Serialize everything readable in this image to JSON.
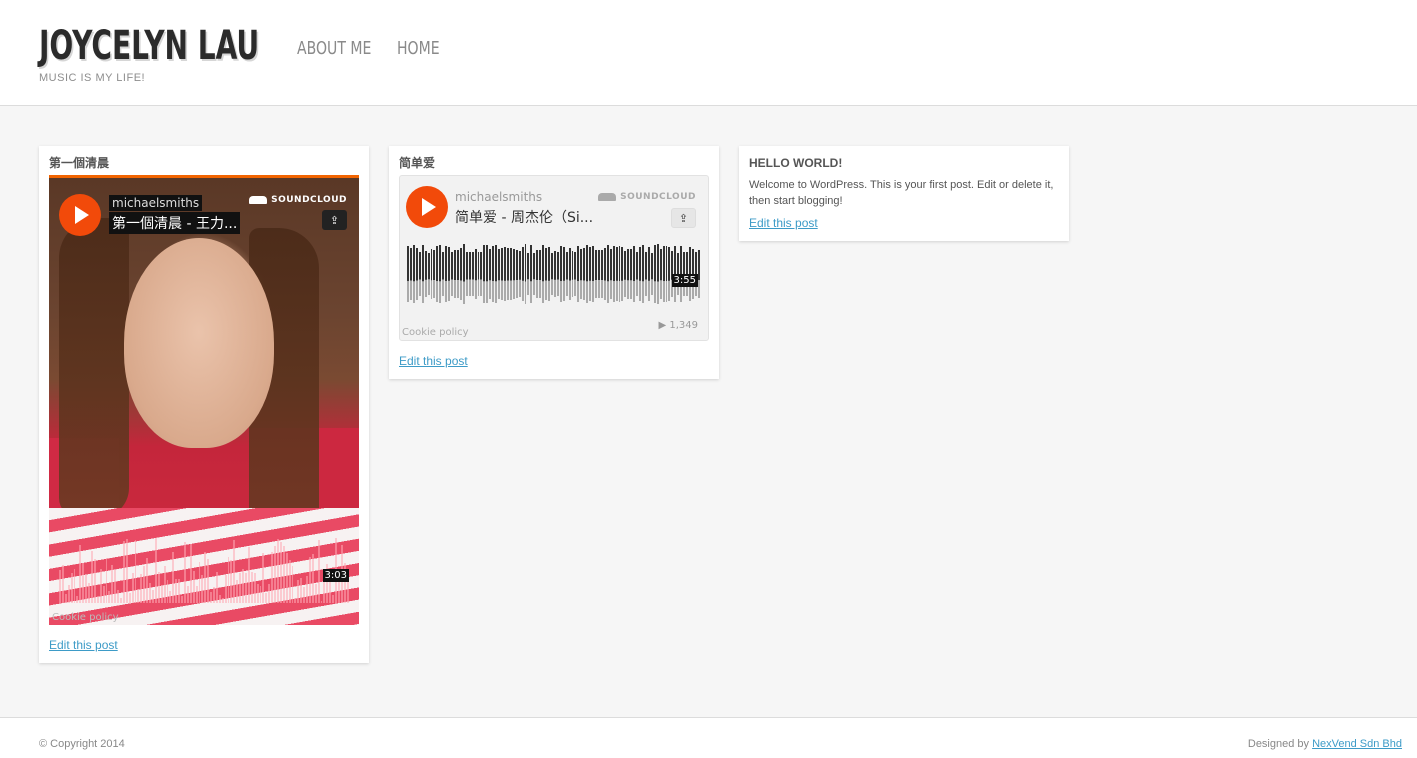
{
  "site": {
    "title": "JOYCELYN LAU",
    "tagline": "MUSIC IS MY LIFE!"
  },
  "nav": {
    "items": [
      "ABOUT ME",
      "HOME"
    ]
  },
  "posts": [
    {
      "title": "第一個清晨",
      "player": {
        "user": "michaelsmiths",
        "track": "第一個清晨 - 王力...",
        "brand": "SOUNDCLOUD",
        "duration": "3:03",
        "cookie": "Cookie policy"
      },
      "edit_label": "Edit this post"
    },
    {
      "title": "简单爱",
      "player": {
        "user": "michaelsmiths",
        "track": "简单爱 - 周杰伦（Si...",
        "brand": "SOUNDCLOUD",
        "duration": "3:55",
        "plays": "▶ 1,349",
        "cookie": "Cookie policy"
      },
      "edit_label": "Edit this post"
    },
    {
      "title": "HELLO WORLD!",
      "body": "Welcome to WordPress. This is your first post. Edit or delete it, then start blogging!",
      "edit_label": "Edit this post"
    }
  ],
  "footer": {
    "copyright": "© Copyright 2014",
    "credit_prefix": "Designed by ",
    "credit_link": "NexVend Sdn Bhd"
  },
  "colors": {
    "accent": "#f24a0a",
    "link": "#3d9bc7",
    "background": "#f6f6f6"
  },
  "icons": [
    "play-icon",
    "soundcloud-logo-icon",
    "share-icon"
  ]
}
